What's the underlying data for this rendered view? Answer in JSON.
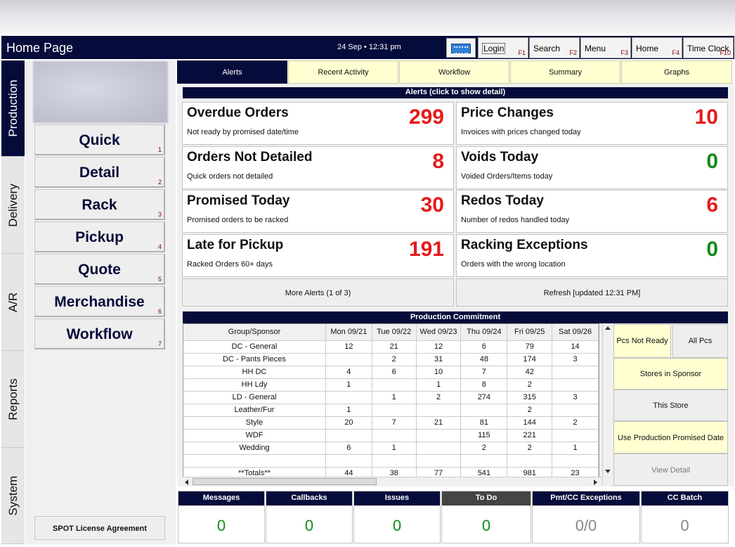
{
  "title": "Home Page",
  "datetime": "24 Sep • 12:31 pm",
  "toolbar": [
    {
      "label": "Login",
      "key": "F1"
    },
    {
      "label": "Search",
      "key": "F2"
    },
    {
      "label": "Menu",
      "key": "F3"
    },
    {
      "label": "Home",
      "key": "F4"
    },
    {
      "label": "Time Clock",
      "key": "F10"
    }
  ],
  "sidebar": [
    "Production",
    "Delivery",
    "A/R",
    "Reports",
    "System"
  ],
  "quick_buttons": [
    {
      "label": "Quick",
      "num": "1"
    },
    {
      "label": "Detail",
      "num": "2"
    },
    {
      "label": "Rack",
      "num": "3"
    },
    {
      "label": "Pickup",
      "num": "4"
    },
    {
      "label": "Quote",
      "num": "5"
    },
    {
      "label": "Merchandise",
      "num": "6"
    },
    {
      "label": "Workflow",
      "num": "7"
    }
  ],
  "license": "SPOT License Agreement",
  "tabs": [
    "Alerts",
    "Recent Activity",
    "Workflow",
    "Summary",
    "Graphs"
  ],
  "alerts_header": "Alerts (click to show detail)",
  "alerts": [
    {
      "title": "Overdue Orders",
      "subtitle": "Not ready by promised date/time",
      "value": "299",
      "color": "#e61a1a"
    },
    {
      "title": "Price Changes",
      "subtitle": "Invoices with prices changed today",
      "value": "10",
      "color": "#e61a1a"
    },
    {
      "title": "Orders Not Detailed",
      "subtitle": "Quick orders not detailed",
      "value": "8",
      "color": "#e61a1a"
    },
    {
      "title": "Voids Today",
      "subtitle": "Voided Orders/Items today",
      "value": "0",
      "color": "#148a14"
    },
    {
      "title": "Promised Today",
      "subtitle": "Promised orders to be racked",
      "value": "30",
      "color": "#e61a1a"
    },
    {
      "title": "Redos Today",
      "subtitle": "Number of redos handled today",
      "value": "6",
      "color": "#e61a1a"
    },
    {
      "title": "Late for Pickup",
      "subtitle": "Racked Orders 60+ days",
      "value": "191",
      "color": "#e61a1a"
    },
    {
      "title": "Racking Exceptions",
      "subtitle": "Orders with the wrong location",
      "value": "0",
      "color": "#148a14"
    }
  ],
  "more_alerts": "More Alerts (1 of 3)",
  "refresh": "Refresh [updated 12:31 PM]",
  "production_header": "Production Commitment",
  "production": {
    "columns": [
      "Group/Sponsor",
      "Mon 09/21",
      "Tue 09/22",
      "Wed 09/23",
      "Thu 09/24",
      "Fri 09/25",
      "Sat 09/26"
    ],
    "rows": [
      [
        "DC - General",
        "12",
        "21",
        "12",
        "6",
        "79",
        "14"
      ],
      [
        "DC - Pants Pieces",
        "",
        "2",
        "31",
        "48",
        "174",
        "3"
      ],
      [
        "HH DC",
        "4",
        "6",
        "10",
        "7",
        "42",
        ""
      ],
      [
        "HH Ldy",
        "1",
        "",
        "1",
        "8",
        "2",
        ""
      ],
      [
        "LD - General",
        "",
        "1",
        "2",
        "274",
        "315",
        "3"
      ],
      [
        "Leather/Fur",
        "1",
        "",
        "",
        "",
        "2",
        ""
      ],
      [
        "Style",
        "20",
        "7",
        "21",
        "81",
        "144",
        "2"
      ],
      [
        "WDF",
        "",
        "",
        "",
        "115",
        "221",
        ""
      ],
      [
        "Wedding",
        "6",
        "1",
        "",
        "2",
        "2",
        "1"
      ],
      [
        "",
        "",
        "",
        "",
        "",
        "",
        ""
      ],
      [
        "**Totals**",
        "44",
        "38",
        "77",
        "541",
        "981",
        "23"
      ]
    ]
  },
  "right_buttons": {
    "pcs_not_ready": "Pcs Not Ready",
    "all_pcs": "All Pcs",
    "stores_in_sponsor": "Stores in Sponsor",
    "this_store": "This Store",
    "use_promised": "Use Production Promised Date",
    "view_detail": "View Detail"
  },
  "bottom": [
    {
      "label": "Messages",
      "value": "0"
    },
    {
      "label": "Callbacks",
      "value": "0"
    },
    {
      "label": "Issues",
      "value": "0"
    },
    {
      "label": "To Do",
      "value": "0"
    },
    {
      "label": "Pmt/CC Exceptions",
      "value": "0/0"
    },
    {
      "label": "CC Batch",
      "value": "0"
    }
  ]
}
